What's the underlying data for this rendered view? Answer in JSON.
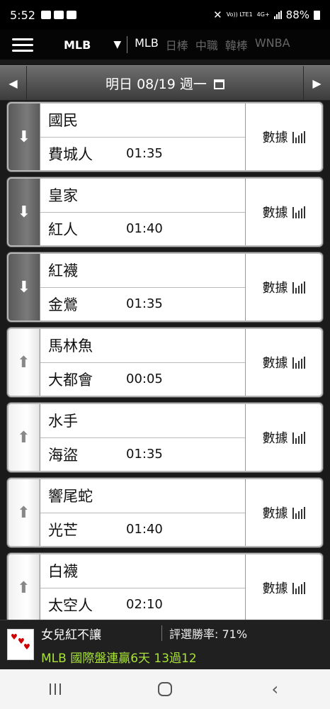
{
  "status_bar": {
    "time": "5:52",
    "signal_text": "4G+",
    "volte": "Vo)) LTE1",
    "battery": "88%"
  },
  "nav": {
    "league": "MLB",
    "dropdown_icon": "triangle-down",
    "tabs": [
      {
        "label": "MLB",
        "active": true
      },
      {
        "label": "日棒",
        "active": false
      },
      {
        "label": "中職",
        "active": false
      },
      {
        "label": "韓棒",
        "active": false
      },
      {
        "label": "WNBA",
        "active": false
      }
    ]
  },
  "date_bar": {
    "label": "明日 08/19 週一",
    "prev_icon": "left-arrow",
    "next_icon": "right-arrow",
    "calendar_icon": "calendar"
  },
  "stats_label": "數據",
  "games": [
    {
      "away": "國民",
      "home": "費城人",
      "time": "01:35",
      "dir": "down"
    },
    {
      "away": "皇家",
      "home": "紅人",
      "time": "01:40",
      "dir": "down"
    },
    {
      "away": "紅襪",
      "home": "金鶯",
      "time": "01:35",
      "dir": "down"
    },
    {
      "away": "馬林魚",
      "home": "大都會",
      "time": "00:05",
      "dir": "up"
    },
    {
      "away": "水手",
      "home": "海盜",
      "time": "01:35",
      "dir": "up"
    },
    {
      "away": "響尾蛇",
      "home": "光芒",
      "time": "01:40",
      "dir": "up"
    },
    {
      "away": "白襪",
      "home": "太空人",
      "time": "02:10",
      "dir": "up"
    }
  ],
  "promo": {
    "name": "女兒紅不讓",
    "rate": "評選勝率: 71%",
    "record": "MLB 國際盤連贏6天 13過12"
  },
  "colors": {
    "record_green": "#a8e23a",
    "card_border": "#b7b7b7",
    "down_side": "#6a6a6a"
  }
}
